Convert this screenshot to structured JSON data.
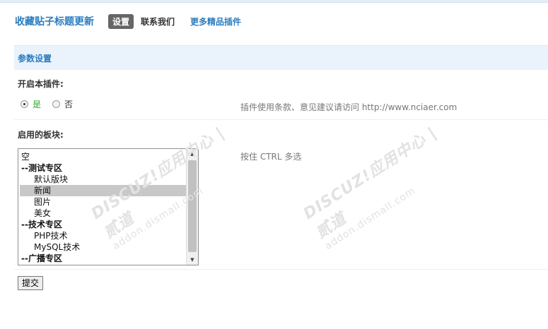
{
  "header": {
    "plugin_title": "收藏贴子标题更新",
    "tabs": [
      {
        "label": "设置",
        "active": true
      },
      {
        "label": "联系我们",
        "active": false
      },
      {
        "label": "更多精品插件",
        "active": false
      }
    ]
  },
  "section": {
    "title": "参数设置"
  },
  "enable_plugin": {
    "label": "开启本插件:",
    "option_yes": "是",
    "option_no": "否",
    "selected": "是",
    "hint": "插件使用条款、意见建议请访问 http://www.nciaer.com"
  },
  "forums": {
    "label": "启用的板块:",
    "hint": "按住 CTRL 多选",
    "items": [
      {
        "label": "空",
        "type": "option"
      },
      {
        "label": "--测试专区",
        "type": "group"
      },
      {
        "label": "默认版块",
        "type": "sub"
      },
      {
        "label": "新闻",
        "type": "sub",
        "selected": true
      },
      {
        "label": "图片",
        "type": "sub"
      },
      {
        "label": "美女",
        "type": "sub"
      },
      {
        "label": "--技术专区",
        "type": "group"
      },
      {
        "label": "PHP技术",
        "type": "sub"
      },
      {
        "label": "MySQL技术",
        "type": "sub"
      },
      {
        "label": "--广播专区",
        "type": "group"
      }
    ]
  },
  "submit_label": "提交",
  "watermark": {
    "brand": "DISCUZ!应用中心 | 贰道",
    "domain": "addon.dismall.com"
  },
  "colors": {
    "accent": "#2b7cbf",
    "section_bg": "#eaf3fb",
    "yes_green": "#2aa82a"
  }
}
